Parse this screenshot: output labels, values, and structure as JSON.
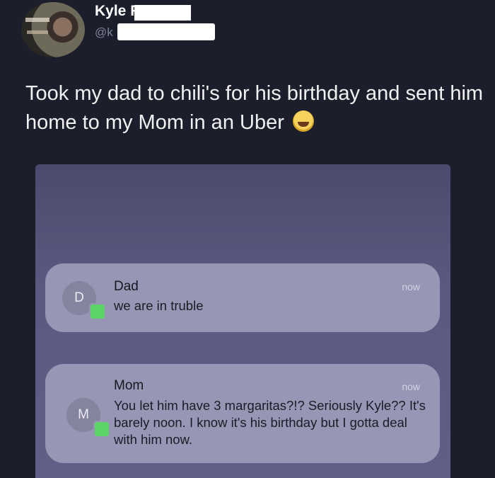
{
  "tweet": {
    "author_name": "Kyle F",
    "author_handle": "@k",
    "text": "Took my dad to chili's for his birthday and sent him home to my Mom in an Uber",
    "emoji_icon": "face-with-tears-of-joy-icon"
  },
  "notifications": [
    {
      "avatar_letter": "D",
      "sender": "Dad",
      "time": "now",
      "message": "we are in truble",
      "app_icon": "messages-icon"
    },
    {
      "avatar_letter": "M",
      "sender": "Mom",
      "time": "now",
      "message": "You let him have 3 margaritas?!? Seriously Kyle?? It's barely noon. I know it's his birthday but I gotta deal with him now.",
      "app_icon": "messages-icon"
    }
  ],
  "colors": {
    "background": "#1c1f2b",
    "notification_bg": "#9796b4",
    "messages_green": "#5cd467"
  }
}
